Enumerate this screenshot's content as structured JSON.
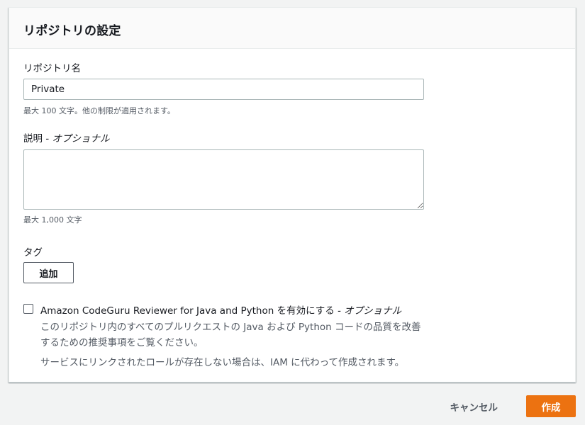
{
  "settings": {
    "title": "リポジトリの設定",
    "repo_name": {
      "label": "リポジトリ名",
      "value": "Private",
      "hint": "最大 100 文字。他の制限が適用されます。"
    },
    "description": {
      "label": "説明",
      "optional": " - オプショナル",
      "value": "",
      "hint": "最大 1,000 文字"
    },
    "tags": {
      "label": "タグ",
      "add_button": "追加"
    },
    "codeguru": {
      "checked": false,
      "label": "Amazon CodeGuru Reviewer for Java and Python を有効にする",
      "optional": " - オプショナル",
      "description1": "このリポジトリ内のすべてのプルリクエストの Java および Python コードの品質を改善するための推奨事項をご覧ください。",
      "description2": "サービスにリンクされたロールが存在しない場合は、IAM に代わって作成されます。"
    }
  },
  "footer": {
    "cancel_label": "キャンセル",
    "create_label": "作成"
  },
  "colors": {
    "primary": "#ec7211",
    "background": "#f2f3f3",
    "text": "#16191f",
    "secondary_text": "#545b64"
  }
}
